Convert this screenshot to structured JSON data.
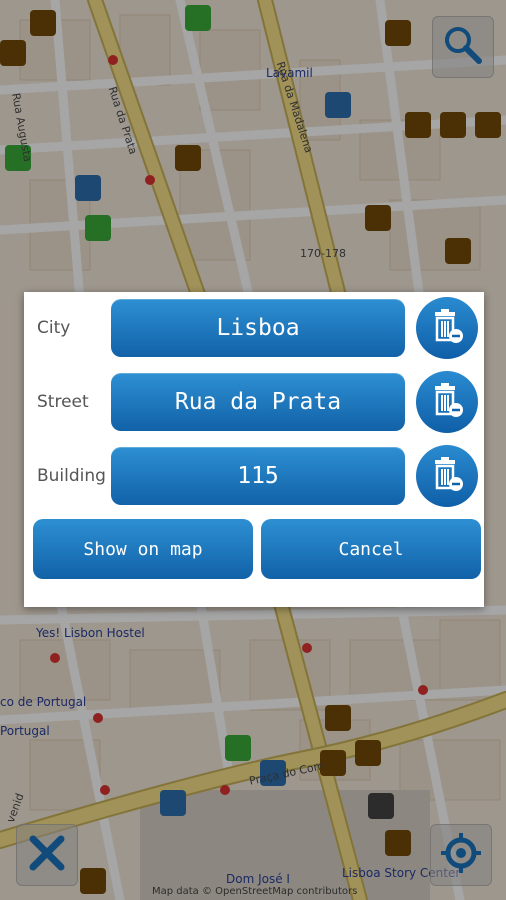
{
  "map": {
    "labels": {
      "lavamil": "Lavamil",
      "rua_augusta": "Rua Augusta",
      "rua_da_prata": "Rua da Prata",
      "rua_da_madalena": "Rua da Madalena",
      "house_numbers": "170-178",
      "yes_lisbon_hostel": "Yes! Lisbon Hostel",
      "banco_de_portugal": "co de Portugal",
      "portugal": "Portugal",
      "praca_do_comercio": "Praça do Com",
      "dom_jose": "Dom José I",
      "lisboa_story_center": "Lisboa Story Center",
      "avenida": "venid"
    },
    "attribution": "Map data © OpenStreetMap contributors",
    "colors": {
      "land": "#f3e9da",
      "street": "#ffffff",
      "main_road": "#f7e08a",
      "road_border": "#c9b35a",
      "poi_brown": "#734a08",
      "poi_green": "#39ac39",
      "poi_blue": "#2d6fb0"
    }
  },
  "controls": {
    "search_icon": "magnifier-icon",
    "close_icon": "close-icon",
    "locate_icon": "locate-icon"
  },
  "dialog": {
    "rows": [
      {
        "label": "City",
        "value": "Lisboa"
      },
      {
        "label": "Street",
        "value": "Rua da Prata"
      },
      {
        "label": "Building",
        "value": "115"
      }
    ],
    "show_on_map": "Show on map",
    "cancel": "Cancel",
    "accent": "#1a74bd"
  }
}
